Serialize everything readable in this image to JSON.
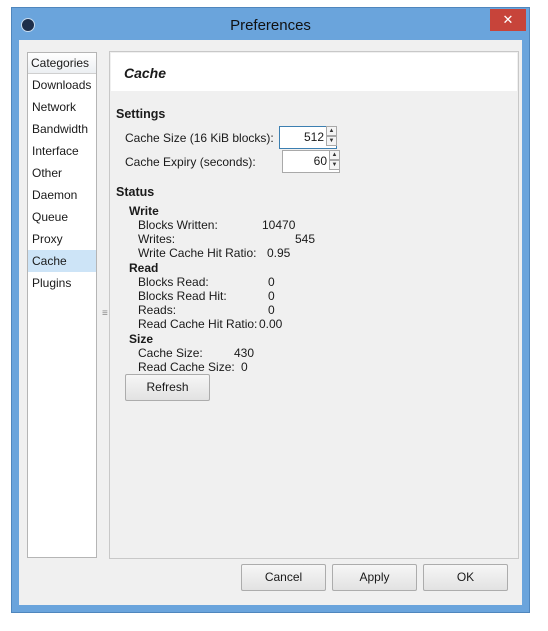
{
  "window": {
    "title": "Preferences",
    "close_label": "✕"
  },
  "categories": {
    "header": "Categories",
    "items": [
      "Downloads",
      "Network",
      "Bandwidth",
      "Interface",
      "Other",
      "Daemon",
      "Queue",
      "Proxy",
      "Cache",
      "Plugins"
    ],
    "selected": "Cache"
  },
  "panel": {
    "title": "Cache",
    "settings": {
      "heading": "Settings",
      "cache_size_label": "Cache Size (16 KiB blocks):",
      "cache_size_value": "512",
      "cache_expiry_label": "Cache Expiry (seconds):",
      "cache_expiry_value": "60"
    },
    "status": {
      "heading": "Status",
      "write": {
        "heading": "Write",
        "blocks_written_label": "Blocks Written:",
        "blocks_written": "10470",
        "writes_label": "Writes:",
        "writes": "545",
        "hit_ratio_label": "Write Cache Hit Ratio:",
        "hit_ratio": "0.95"
      },
      "read": {
        "heading": "Read",
        "blocks_read_label": "Blocks Read:",
        "blocks_read": "0",
        "blocks_read_hit_label": "Blocks Read Hit:",
        "blocks_read_hit": "0",
        "reads_label": "Reads:",
        "reads": "0",
        "hit_ratio_label": "Read Cache Hit Ratio:",
        "hit_ratio": "0.00"
      },
      "size": {
        "heading": "Size",
        "cache_size_label": "Cache Size:",
        "cache_size": "430",
        "read_cache_size_label": "Read Cache Size:",
        "read_cache_size": "0"
      }
    },
    "refresh_label": "Refresh"
  },
  "buttons": {
    "cancel": "Cancel",
    "apply": "Apply",
    "ok": "OK"
  },
  "colors": {
    "frame": "#6aa4dc",
    "close": "#c7443a",
    "selected": "#cde4f7"
  }
}
